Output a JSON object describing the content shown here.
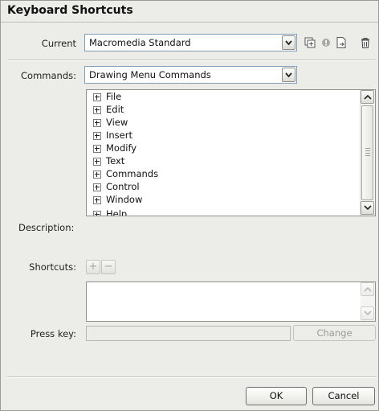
{
  "dialog": {
    "title": "Keyboard Shortcuts"
  },
  "current": {
    "label": "Current",
    "value": "Macromedia Standard"
  },
  "toolbar_icons": [
    "duplicate-set-icon",
    "rename-set-icon",
    "export-set-icon",
    "delete-set-icon"
  ],
  "commands": {
    "label": "Commands:",
    "value": "Drawing Menu Commands",
    "items": [
      "File",
      "Edit",
      "View",
      "Insert",
      "Modify",
      "Text",
      "Commands",
      "Control",
      "Window",
      "Help"
    ]
  },
  "description": {
    "label": "Description:"
  },
  "shortcuts": {
    "label": "Shortcuts:",
    "add": "+",
    "remove": "−"
  },
  "press_key": {
    "label": "Press key:",
    "change_label": "Change"
  },
  "buttons": {
    "ok": "OK",
    "cancel": "Cancel"
  },
  "colors": {
    "field_border": "#7f9db9",
    "dialog_bg": "#ecece8"
  }
}
